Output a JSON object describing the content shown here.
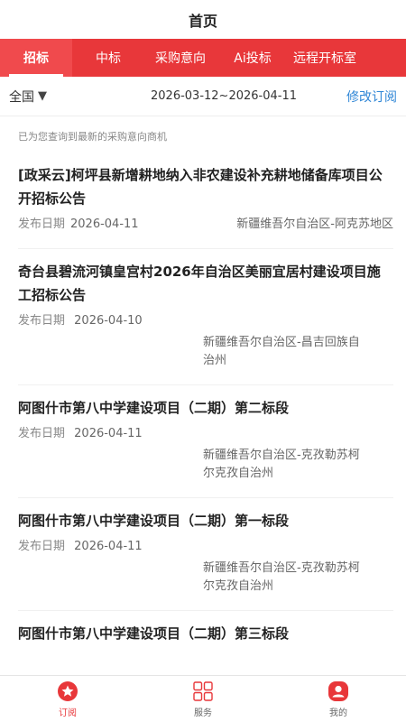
{
  "header": {
    "title": "首页"
  },
  "tabs": [
    {
      "label": "招标",
      "active": true
    },
    {
      "label": "中标",
      "active": false
    },
    {
      "label": "采购意向",
      "active": false
    },
    {
      "label": "Ai投标",
      "active": false
    },
    {
      "label": "远程开标室",
      "active": false
    }
  ],
  "filter": {
    "region": "全国",
    "date_range": "2026-03-12~2026-04-11",
    "edit_label": "修改订阅"
  },
  "notice": "已为您查询到最新的采购意向商机",
  "date_label": "发布日期",
  "items": [
    {
      "title": "[政采云]柯坪县新增耕地纳入非农建设补充耕地储备库项目公开招标公告",
      "date": "2026-04-11",
      "region": "新疆维吾尔自治区-阿克苏地区"
    },
    {
      "title": "奇台县碧流河镇皇宫村2026年自治区美丽宜居村建设项目施工招标公告",
      "date": "2026-04-10",
      "region": "新疆维吾尔自治区-昌吉回族自治州"
    },
    {
      "title": "阿图什市第八中学建设项目（二期）第二标段",
      "date": "2026-04-11",
      "region": "新疆维吾尔自治区-克孜勒苏柯尔克孜自治州"
    },
    {
      "title": "阿图什市第八中学建设项目（二期）第一标段",
      "date": "2026-04-11",
      "region": "新疆维吾尔自治区-克孜勒苏柯尔克孜自治州"
    },
    {
      "title": "阿图什市第八中学建设项目（二期）第三标段"
    }
  ],
  "bottom_nav": [
    {
      "label": "订阅",
      "icon": "subscribe-icon",
      "active": true
    },
    {
      "label": "服务",
      "icon": "grid-icon",
      "active": false
    },
    {
      "label": "我的",
      "icon": "user-icon",
      "active": false
    }
  ],
  "colors": {
    "brand_red": "#e8373a",
    "link_blue": "#2f86d6"
  }
}
